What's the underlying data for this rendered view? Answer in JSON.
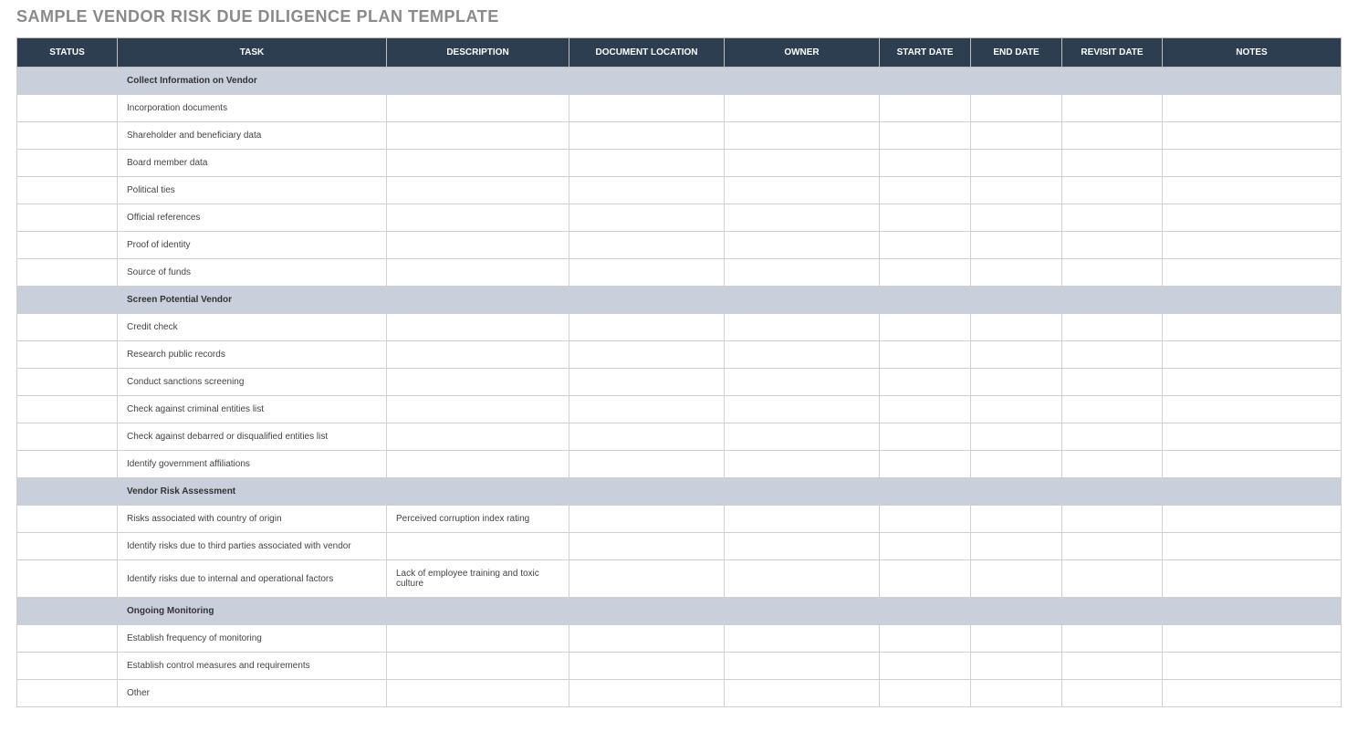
{
  "title": "SAMPLE VENDOR RISK DUE DILIGENCE PLAN TEMPLATE",
  "columns": [
    "STATUS",
    "TASK",
    "DESCRIPTION",
    "DOCUMENT LOCATION",
    "OWNER",
    "START DATE",
    "END DATE",
    "REVISIT DATE",
    "NOTES"
  ],
  "rows": [
    {
      "type": "section",
      "task": "Collect Information on Vendor"
    },
    {
      "type": "item",
      "task": "Incorporation documents"
    },
    {
      "type": "item",
      "task": "Shareholder and beneficiary data"
    },
    {
      "type": "item",
      "task": "Board member data"
    },
    {
      "type": "item",
      "task": "Political ties"
    },
    {
      "type": "item",
      "task": "Official references"
    },
    {
      "type": "item",
      "task": "Proof of identity"
    },
    {
      "type": "item",
      "task": "Source of funds"
    },
    {
      "type": "section",
      "task": "Screen Potential Vendor"
    },
    {
      "type": "item",
      "task": "Credit check"
    },
    {
      "type": "item",
      "task": "Research public records"
    },
    {
      "type": "item",
      "task": "Conduct sanctions screening"
    },
    {
      "type": "item",
      "task": "Check against criminal entities list"
    },
    {
      "type": "item",
      "task": "Check against debarred or disqualified entities list"
    },
    {
      "type": "item",
      "task": "Identify government affiliations"
    },
    {
      "type": "section",
      "task": "Vendor Risk Assessment"
    },
    {
      "type": "item",
      "task": "Risks associated with country of origin",
      "description": "Perceived corruption index rating"
    },
    {
      "type": "item",
      "task": "Identify risks due to third parties associated with vendor"
    },
    {
      "type": "item",
      "task": "Identify risks due to internal and operational factors",
      "description": "Lack of employee training and toxic culture"
    },
    {
      "type": "section",
      "task": "Ongoing Monitoring"
    },
    {
      "type": "item",
      "task": "Establish frequency of monitoring"
    },
    {
      "type": "item",
      "task": "Establish control measures and requirements"
    },
    {
      "type": "item",
      "task": "Other"
    }
  ]
}
